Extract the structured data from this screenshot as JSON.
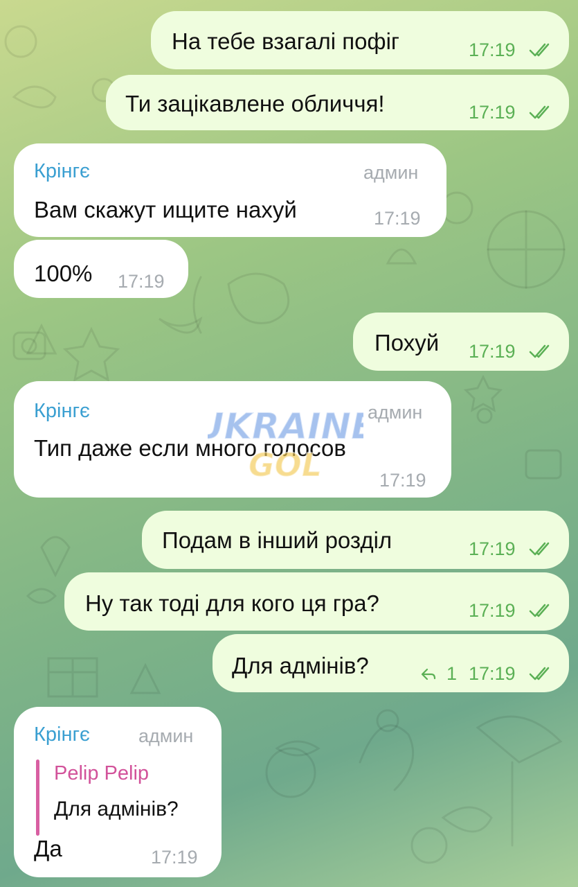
{
  "messages": [
    {
      "text": "На тебе взагалі пофіг",
      "time": "17:19"
    },
    {
      "text": "Ти зацікавлене обличчя!",
      "time": "17:19"
    },
    {
      "sender": "Крінгє",
      "role": "админ",
      "text": "Вам скажут ищите нахуй",
      "time": "17:19"
    },
    {
      "text": "100%",
      "time": "17:19"
    },
    {
      "text": "Похуй",
      "time": "17:19"
    },
    {
      "sender": "Крінгє",
      "role": "админ",
      "text": "Тип даже если много голосов",
      "time": "17:19"
    },
    {
      "text": "Подам в інший розділ",
      "time": "17:19"
    },
    {
      "text": "Ну так тоді для кого ця гра?",
      "time": "17:19"
    },
    {
      "text": "Для адмінів?",
      "replies": "1",
      "time": "17:19"
    },
    {
      "sender": "Крінгє",
      "role": "админ",
      "reply_name": "Pelip Pelip",
      "reply_text": "Для адмінів?",
      "text": "Да",
      "time": "17:19"
    }
  ],
  "watermark": {
    "line1": "UKRAINE",
    "line2": "GOL"
  },
  "colors": {
    "outgoing": "#effdde",
    "incoming": "#ffffff",
    "sender": "#3a9fd1",
    "check": "#5bb055",
    "reply_accent": "#d2529a"
  }
}
